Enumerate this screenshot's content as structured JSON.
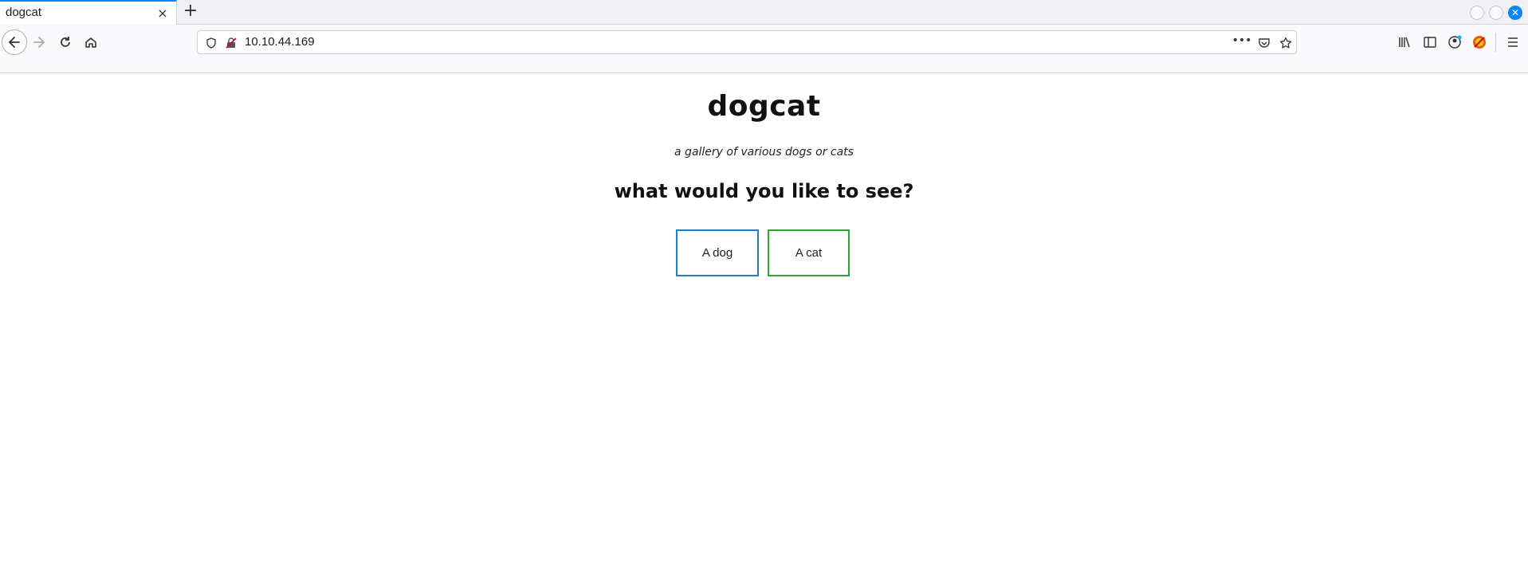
{
  "browser": {
    "tab_title": "dogcat",
    "tab_close": "×",
    "newtab_label": "+",
    "url": "10.10.44.169",
    "page_actions_label": "•••"
  },
  "page": {
    "title": "dogcat",
    "subtitle": "a gallery of various dogs or cats",
    "question": "what would you like to see?",
    "buttons": {
      "dog": "A dog",
      "cat": "A cat"
    }
  },
  "colors": {
    "dog_border": "#1a7fc4",
    "cat_border": "#2ea33a",
    "tab_accent": "#0a84ff"
  },
  "icons": [
    "back-arrow-icon",
    "forward-arrow-icon",
    "reload-icon",
    "home-icon",
    "shield-icon",
    "insecure-lock-icon",
    "page-actions-icon",
    "pocket-icon",
    "bookmark-star-icon",
    "library-icon",
    "sidebar-icon",
    "account-icon",
    "extension-icon",
    "menu-icon"
  ]
}
